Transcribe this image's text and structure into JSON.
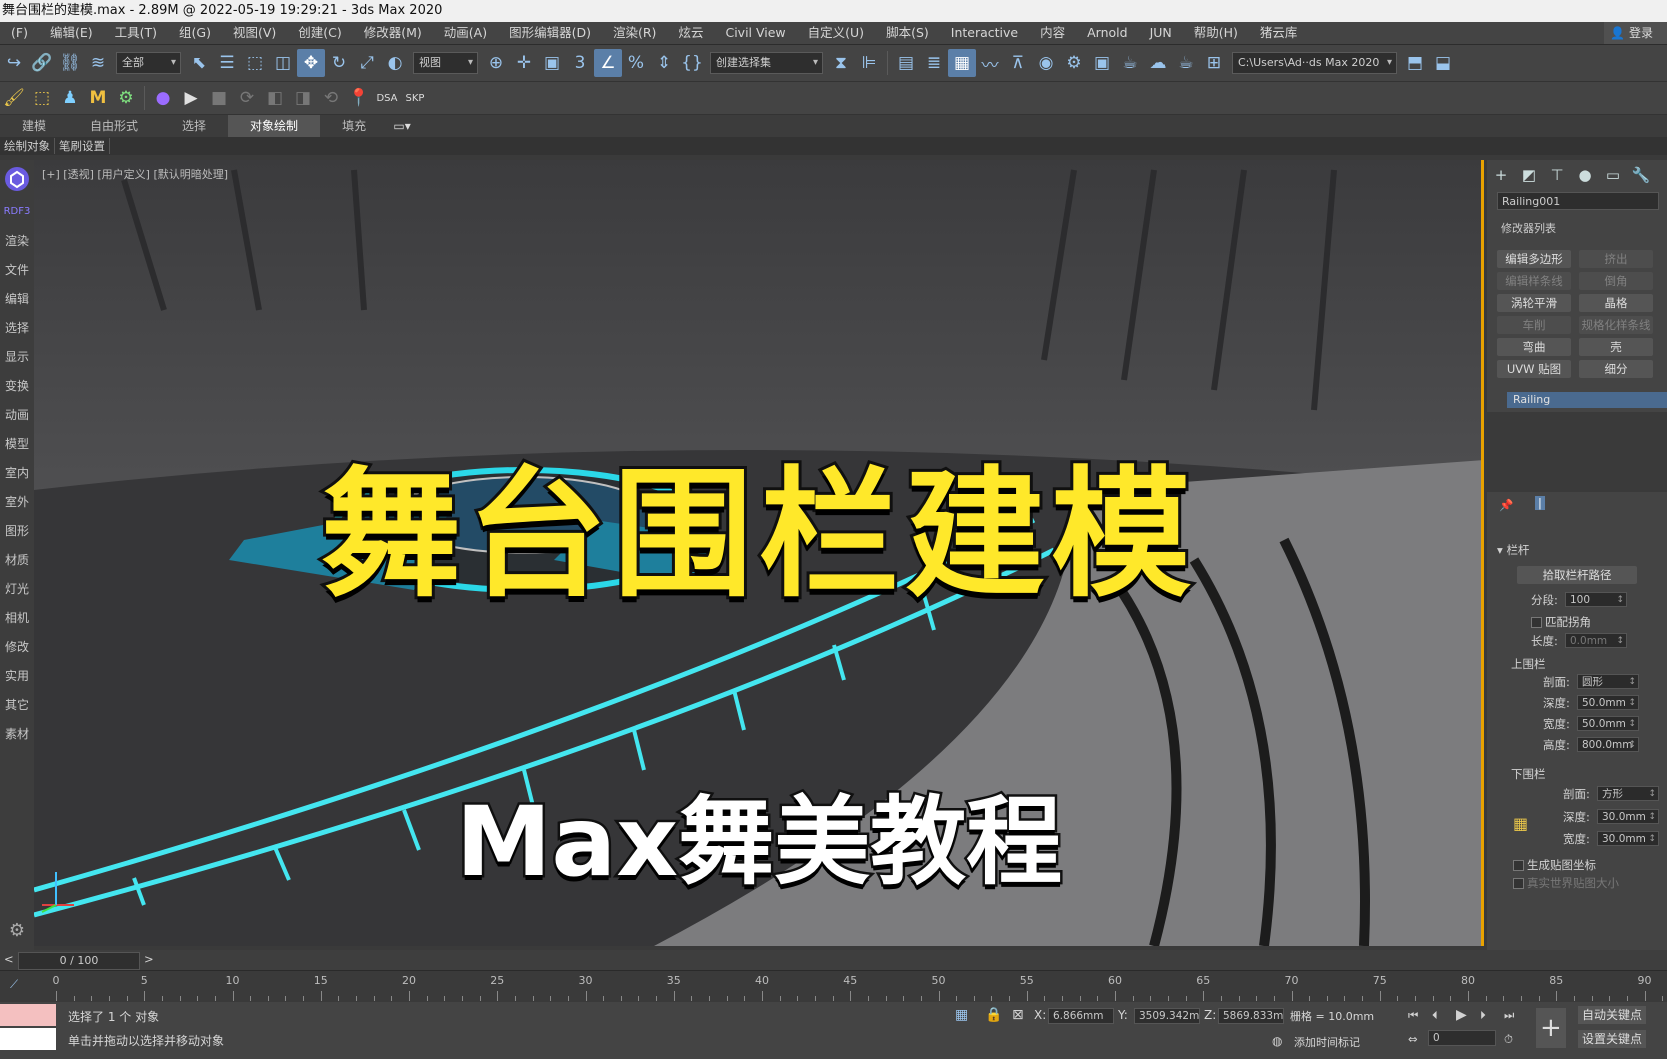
{
  "window_title": "舞台围栏的建模.max - 2.89M @ 2022-05-19 19:29:21 - 3ds Max 2020",
  "menu": [
    "(F)",
    "编辑(E)",
    "工具(T)",
    "组(G)",
    "视图(V)",
    "创建(C)",
    "修改器(M)",
    "动画(A)",
    "图形编辑器(D)",
    "渲染(R)",
    "炫云",
    "Civil View",
    "自定义(U)",
    "脚本(S)",
    "Interactive",
    "内容",
    "Arnold",
    "JUN",
    "帮助(H)",
    "猪云库"
  ],
  "login_label": "登录",
  "toolbar": {
    "filter_dropdown": "全部",
    "view_dropdown": "视图",
    "selection_set_dropdown": "创建选择集",
    "path_dropdown": "C:\\Users\\Ad··ds Max 2020"
  },
  "toolbar2_labels": [
    "DSA",
    "SKP"
  ],
  "ribbon_tabs": [
    "建模",
    "自由形式",
    "选择",
    "对象绘制",
    "填充"
  ],
  "ribbon_active": "对象绘制",
  "ribbon_row": [
    "绘制对象",
    "笔刷设置"
  ],
  "left_bar": [
    "RDF3",
    "渲染",
    "文件",
    "编辑",
    "选择",
    "显示",
    "变换",
    "动画",
    "模型",
    "室内",
    "室外",
    "图形",
    "材质",
    "灯光",
    "相机",
    "修改",
    "实用",
    "其它",
    "素材"
  ],
  "viewport_label": "[+] [透视] [用户定义] [默认明暗处理]",
  "overlay": {
    "title": "舞台围栏建模",
    "subtitle": "Max舞美教程"
  },
  "command_panel": {
    "object_name": "Railing001",
    "modifier_list": "修改器列表",
    "buttons": [
      {
        "label": "编辑多边形",
        "dim": false
      },
      {
        "label": "挤出",
        "dim": true
      },
      {
        "label": "编辑样条线",
        "dim": true
      },
      {
        "label": "倒角",
        "dim": true
      },
      {
        "label": "涡轮平滑",
        "dim": false
      },
      {
        "label": "晶格",
        "dim": false
      },
      {
        "label": "车削",
        "dim": true
      },
      {
        "label": "规格化样条线",
        "dim": true
      },
      {
        "label": "弯曲",
        "dim": false
      },
      {
        "label": "壳",
        "dim": false
      },
      {
        "label": "UVW 贴图",
        "dim": false
      },
      {
        "label": "细分",
        "dim": false
      }
    ],
    "stack_item": "Railing",
    "rollout_title": "栏杆",
    "pick_path_btn": "拾取栏杆路径",
    "segments_label": "分段:",
    "segments_value": "100",
    "match_corners": "匹配拐角",
    "length_label": "长度:",
    "length_value": "0.0mm",
    "upper_rail": "上围栏",
    "upper_profile_label": "剖面:",
    "upper_profile_value": "圆形",
    "upper_depth_label": "深度:",
    "upper_depth_value": "50.0mm",
    "upper_width_label": "宽度:",
    "upper_width_value": "50.0mm",
    "upper_height_label": "高度:",
    "upper_height_value": "800.0mm",
    "lower_rail": "下围栏",
    "lower_profile_label": "剖面:",
    "lower_profile_value": "方形",
    "lower_depth_label": "深度:",
    "lower_depth_value": "30.0mm",
    "lower_width_label": "宽度:",
    "lower_width_value": "30.0mm",
    "gen_map_coords": "生成贴图坐标",
    "real_world_map": "真实世界贴图大小"
  },
  "time_slider": "0 / 100",
  "track_ticks": [
    "0",
    "5",
    "10",
    "15",
    "20",
    "25",
    "30",
    "35",
    "40",
    "45",
    "50",
    "55",
    "60",
    "65",
    "70",
    "75",
    "80",
    "85",
    "90"
  ],
  "status": {
    "selected": "选择了 1 个 对象",
    "prompt": "单击并拖动以选择并移动对象",
    "x_label": "X:",
    "x_value": "6.866mm",
    "y_label": "Y:",
    "y_value": "3509.342m",
    "z_label": "Z:",
    "z_value": "5869.833m",
    "grid": "栅格 = 10.0mm",
    "add_time_tag": "添加时间标记",
    "auto_key": "自动关键点",
    "set_key": "设置关键点",
    "frame_value": "0"
  },
  "colors": {
    "accent_blue": "#5b7fa8",
    "title_yellow": "#ffe82a",
    "cyan_rail": "#44e6f0",
    "viewport_border": "#e9a200"
  }
}
